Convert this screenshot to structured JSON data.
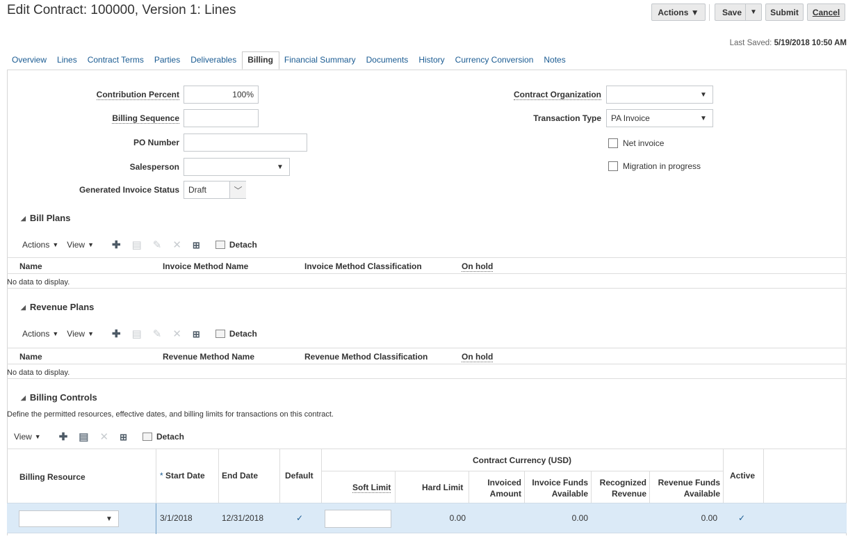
{
  "header": {
    "title": "Edit Contract: 100000, Version 1: Lines",
    "actions_label": "Actions ▼",
    "save_label": "Save",
    "submit_label": "Submit",
    "cancel_label": "Cancel",
    "last_saved_label": "Last Saved:",
    "last_saved_value": "5/19/2018 10:50 AM"
  },
  "tabs": [
    "Overview",
    "Lines",
    "Contract Terms",
    "Parties",
    "Deliverables",
    "Billing",
    "Financial Summary",
    "Documents",
    "History",
    "Currency Conversion",
    "Notes"
  ],
  "active_tab": "Billing",
  "form": {
    "contribution_percent_label": "Contribution Percent",
    "contribution_percent_value": "100%",
    "billing_sequence_label": "Billing Sequence",
    "billing_sequence_value": "",
    "po_number_label": "PO Number",
    "po_number_value": "",
    "salesperson_label": "Salesperson",
    "salesperson_value": "",
    "generated_invoice_status_label": "Generated Invoice Status",
    "generated_invoice_status_value": "Draft",
    "contract_organization_label": "Contract Organization",
    "contract_organization_value": "",
    "transaction_type_label": "Transaction Type",
    "transaction_type_value": "PA Invoice",
    "net_invoice_label": "Net invoice",
    "net_invoice_checked": false,
    "migration_label": "Migration in progress",
    "migration_checked": false
  },
  "bill_plans": {
    "title": "Bill Plans",
    "toolbar": {
      "actions": "Actions",
      "view": "View",
      "detach": "Detach"
    },
    "columns": [
      "Name",
      "Invoice Method Name",
      "Invoice Method Classification",
      "On hold"
    ],
    "empty_text": "No data to display."
  },
  "revenue_plans": {
    "title": "Revenue Plans",
    "toolbar": {
      "actions": "Actions",
      "view": "View",
      "detach": "Detach"
    },
    "columns": [
      "Name",
      "Revenue Method Name",
      "Revenue Method Classification",
      "On hold"
    ],
    "empty_text": "No data to display."
  },
  "billing_controls": {
    "title": "Billing Controls",
    "description": "Define the permitted resources, effective dates, and billing limits for transactions on this contract.",
    "toolbar": {
      "view": "View",
      "detach": "Detach"
    },
    "columns": {
      "billing_resource": "Billing Resource",
      "required_mark": "*",
      "start_date": "Start Date",
      "end_date": "End Date",
      "default": "Default",
      "contract_currency": "Contract Currency (USD)",
      "soft_limit": "Soft Limit",
      "hard_limit": "Hard Limit",
      "invoiced_amount_1": "Invoiced",
      "invoiced_amount_2": "Amount",
      "invoice_funds_1": "Invoice Funds",
      "invoice_funds_2": "Available",
      "recognized_revenue_1": "Recognized",
      "recognized_revenue_2": "Revenue",
      "revenue_funds_1": "Revenue Funds",
      "revenue_funds_2": "Available",
      "active": "Active"
    },
    "rows": [
      {
        "billing_resource": "",
        "start_date": "3/1/2018",
        "end_date": "12/31/2018",
        "default": "✓",
        "soft_limit": "",
        "invoiced_amount": "0.00",
        "invoice_funds_available": "0.00",
        "revenue_funds_available": "0.00",
        "active": "✓"
      }
    ]
  }
}
